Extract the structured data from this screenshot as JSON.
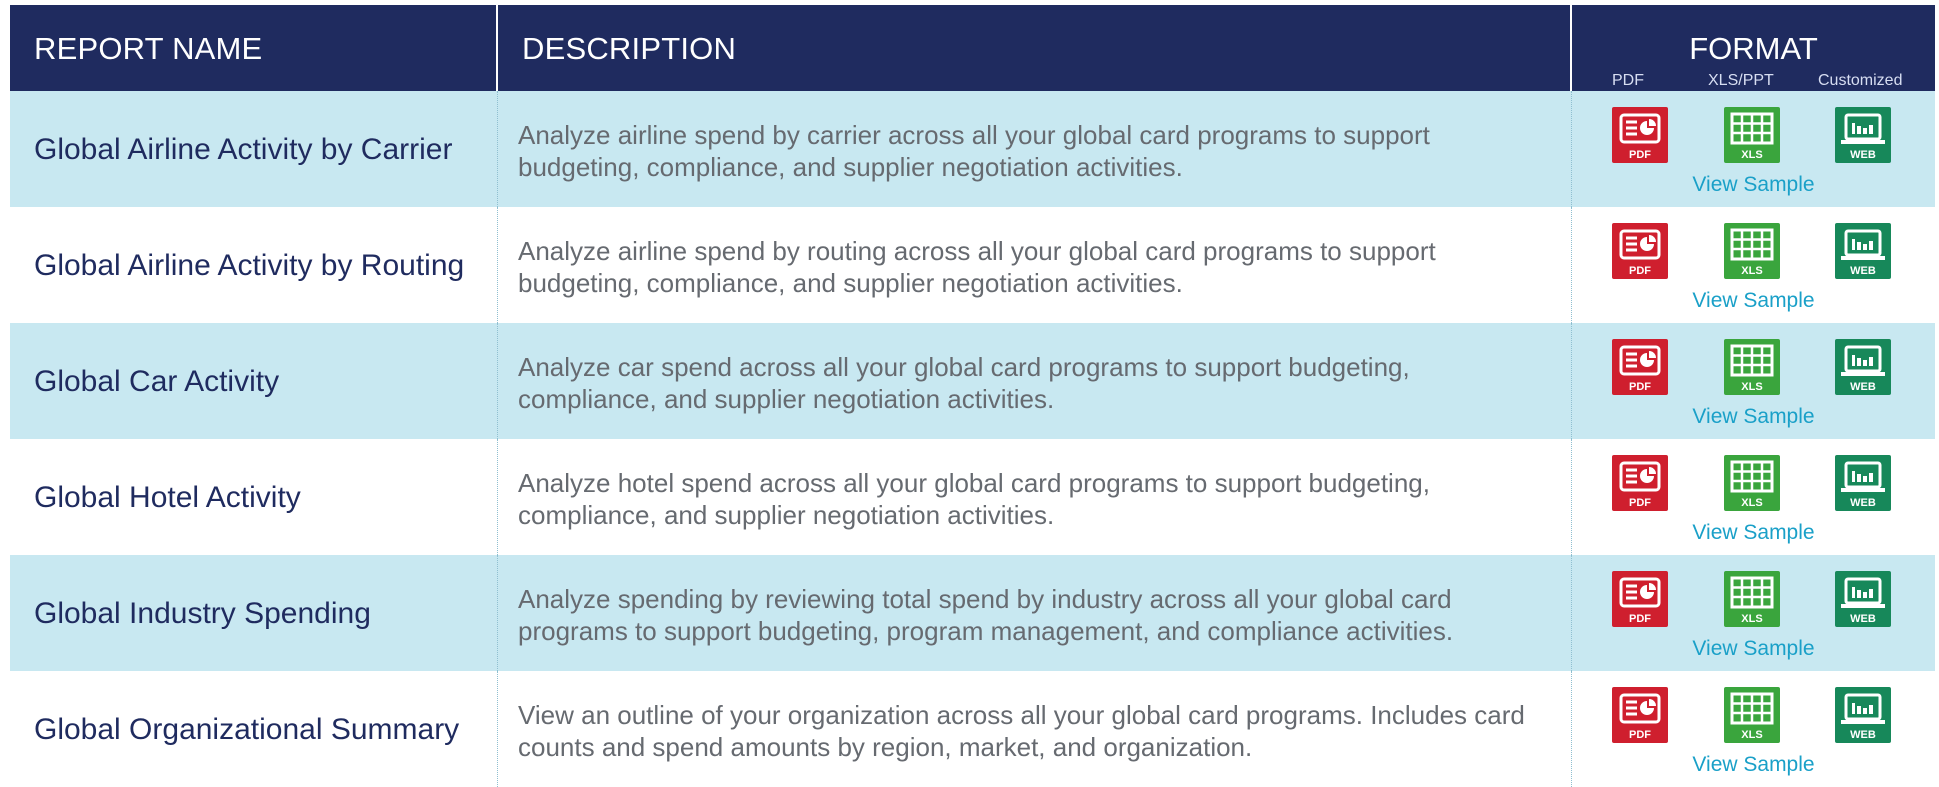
{
  "header": {
    "report_name": "REPORT NAME",
    "description": "DESCRIPTION",
    "format": "FORMAT",
    "format_pdf": "PDF",
    "format_xls": "XLS/PPT",
    "format_web": "Customized"
  },
  "colors": {
    "header_bg": "#1f2b5f",
    "alt_row_bg": "#c8e8f1",
    "pdf_red": "#cf1f2e",
    "xls_green": "#3aa53d",
    "web_green": "#17885a",
    "link_blue": "#1aa0c8"
  },
  "icons": {
    "pdf": "pdf-file-icon",
    "xls": "xls-spreadsheet-icon",
    "web": "web-chart-icon",
    "pdf_label": "PDF",
    "xls_label": "XLS",
    "web_label": "WEB"
  },
  "rows": [
    {
      "name": "Global Airline Activity by Carrier",
      "description": "Analyze airline spend by carrier across all your global card programs to support budgeting, compliance, and supplier negotiation activities.",
      "link": "View Sample"
    },
    {
      "name": "Global Airline Activity by Routing",
      "description": "Analyze airline spend by routing across all your global card programs to support budgeting, compliance, and supplier negotiation activities.",
      "link": "View Sample"
    },
    {
      "name": "Global Car Activity",
      "description": "Analyze car spend across all your global card programs to support budgeting, compliance, and supplier negotiation activities.",
      "link": "View Sample"
    },
    {
      "name": "Global Hotel Activity",
      "description": "Analyze hotel spend across all your global card programs to support budgeting, compliance, and supplier negotiation activities.",
      "link": "View Sample"
    },
    {
      "name": "Global Industry Spending",
      "description": "Analyze spending by reviewing total spend by industry across all your global card programs to support budgeting, program management, and compliance activities.",
      "link": "View Sample"
    },
    {
      "name": "Global Organizational Summary",
      "description": "View an outline of your organization across all your global card programs. Includes card counts and spend amounts by region, market, and organization.",
      "link": "View Sample"
    }
  ]
}
